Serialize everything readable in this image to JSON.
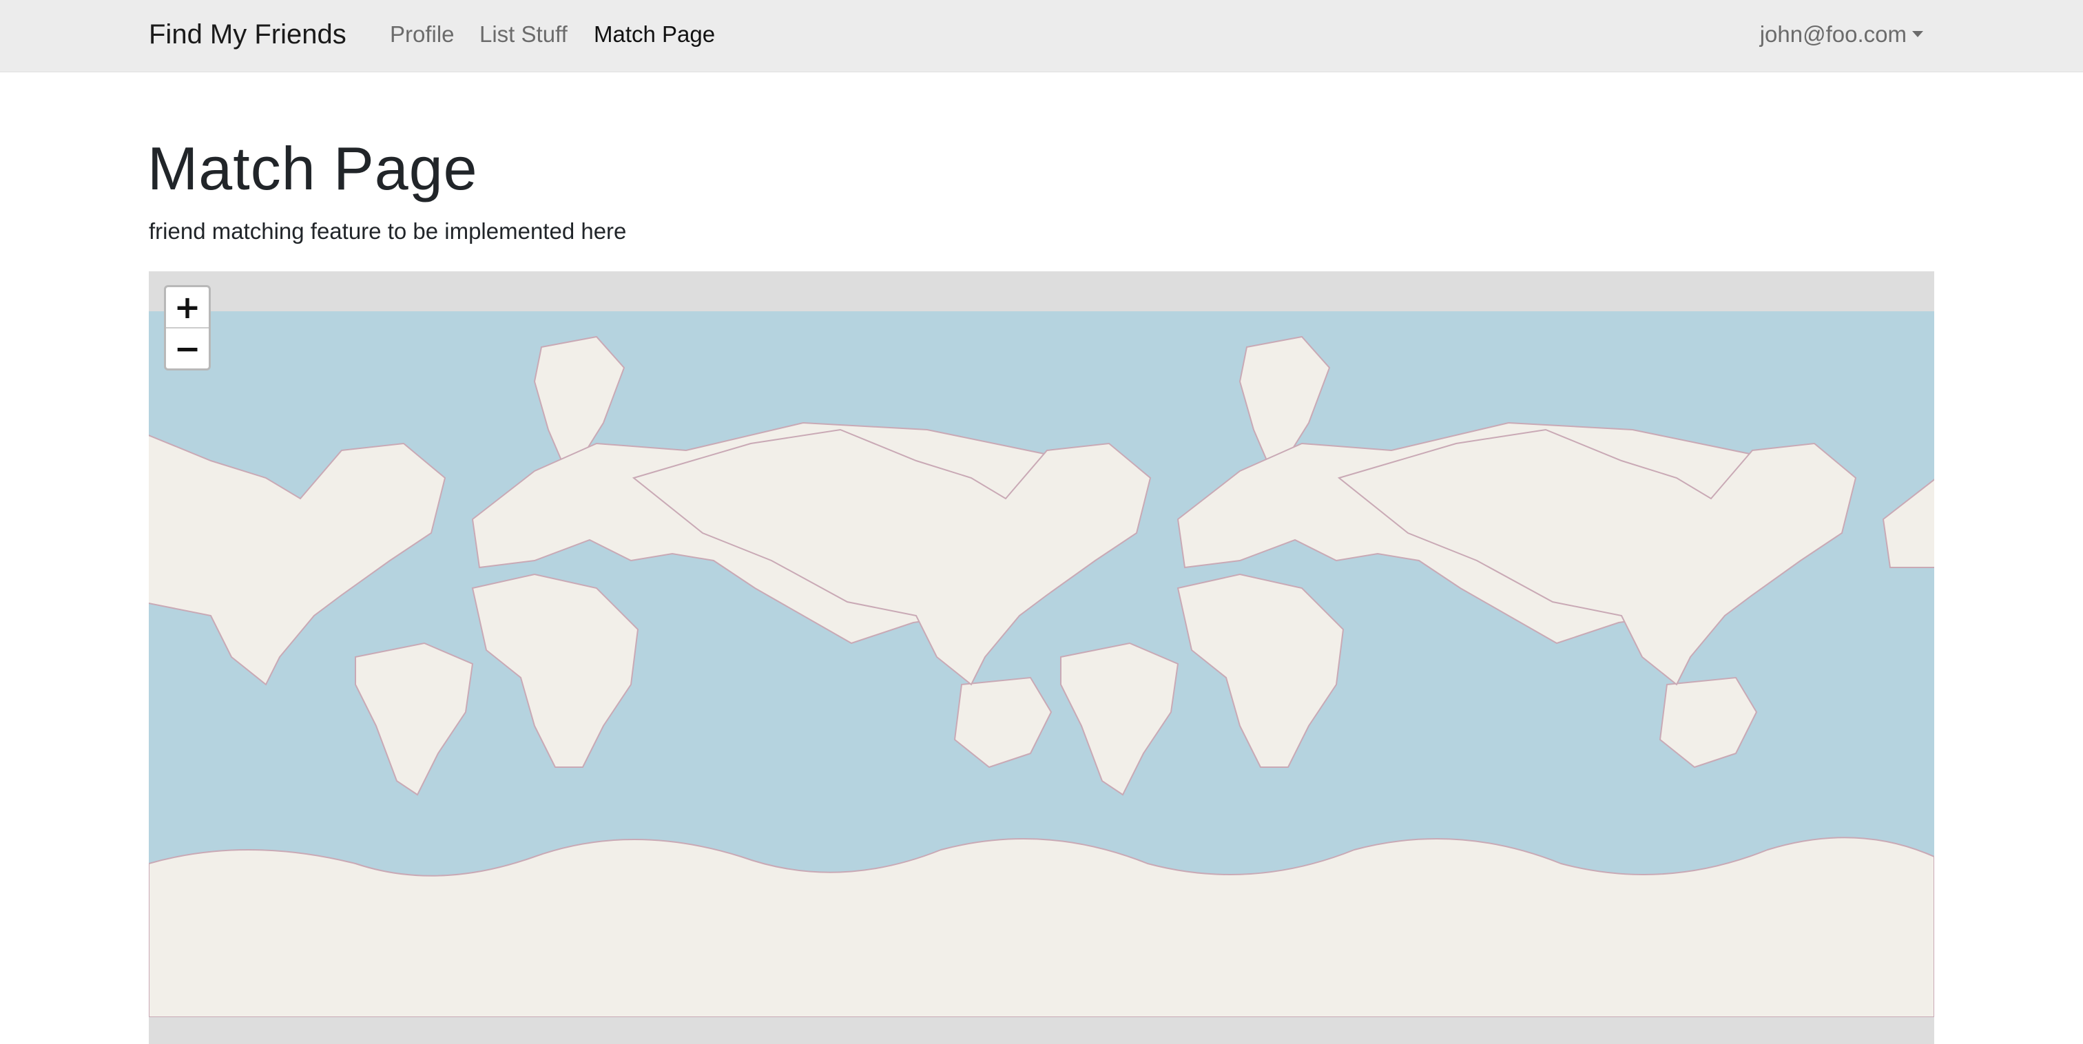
{
  "navbar": {
    "brand": "Find My Friends",
    "links": [
      {
        "label": "Profile",
        "active": false
      },
      {
        "label": "List Stuff",
        "active": false
      },
      {
        "label": "Match Page",
        "active": true
      }
    ],
    "user_menu": "john@foo.com"
  },
  "main": {
    "title": "Match Page",
    "subtitle": "friend matching feature to be implemented here"
  },
  "map": {
    "zoom_in_label": "+",
    "zoom_out_label": "−",
    "colors": {
      "ocean": "#b5d3df",
      "land": "#f2efe9",
      "border": "#c9a9b5",
      "outside": "#dddddd"
    }
  }
}
